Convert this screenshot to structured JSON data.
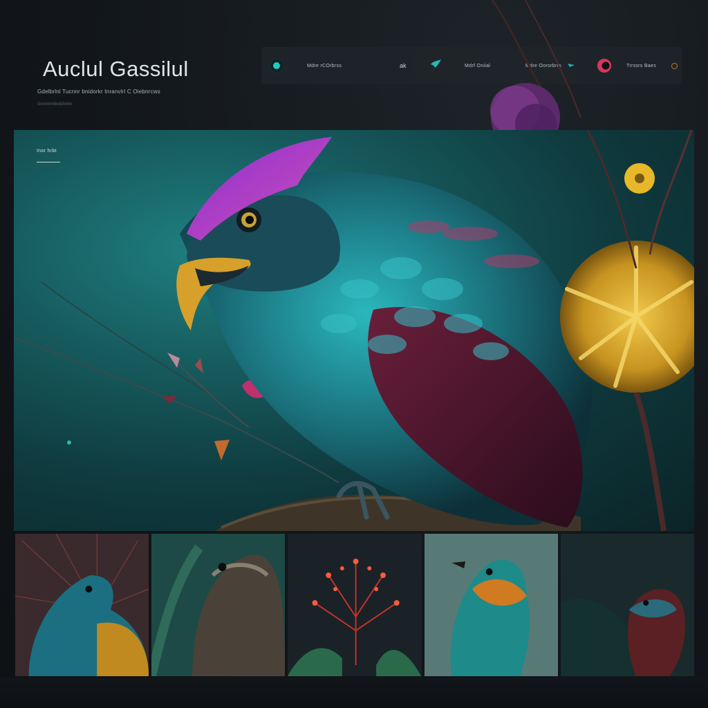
{
  "brand": {
    "title": "Auclul Gassilul",
    "subtitle": "Gdelbrlnl Tucnnr bnidorkr tnranvlrl C Oiebnrcws",
    "tagline": "Gnnmnrnbrdshnbn"
  },
  "nav": {
    "items": [
      {
        "label": "Mdre rCOrbrss",
        "icon": "teal-dot-icon",
        "color": "#1ec9c4"
      },
      {
        "label": "ak",
        "icon": "small-glyph-icon"
      },
      {
        "label": "Mdrf Oniial",
        "icon": "bird-teal-icon",
        "color": "#27b7b5"
      },
      {
        "label": "Mdre Oororbrrs",
        "icon": "arrow-icon",
        "color": "#2aa7b0"
      },
      {
        "label": "Trrssrs Baes",
        "icon": "pink-dot-icon",
        "color": "#d8365d"
      }
    ]
  },
  "hero": {
    "label": "Inor hrbt"
  },
  "gallery": {
    "items": [
      {
        "name": "peacock-bird-thumb"
      },
      {
        "name": "owl-thumb"
      },
      {
        "name": "red-bloom-thumb"
      },
      {
        "name": "orange-bird-thumb"
      },
      {
        "name": "dark-bird-thumb"
      }
    ]
  },
  "colors": {
    "accent_teal": "#1ec9c4",
    "accent_pink": "#d8365d",
    "accent_purple": "#9b3fd1",
    "accent_gold": "#e2b022",
    "background": "#15191d"
  }
}
